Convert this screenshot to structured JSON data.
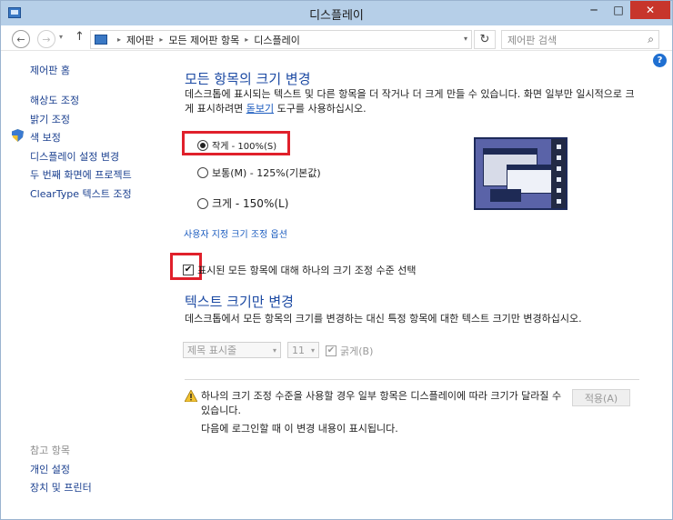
{
  "window": {
    "title": "디스플레이",
    "controls": {
      "minimize": "─",
      "maximize": "□",
      "close": "✕"
    }
  },
  "navbar": {
    "back": "←",
    "forward": "→",
    "dropdown": "▾",
    "up": "↑",
    "breadcrumbs": [
      "제어판",
      "모든 제어판 항목",
      "디스플레이"
    ],
    "crumb_separator": "▸",
    "address_dropdown": "▾",
    "refresh": "↻",
    "search_placeholder": "제어판 검색",
    "search_icon": "⌕"
  },
  "help": {
    "label": "?"
  },
  "sidebar": {
    "home": "제어판 홈",
    "items": [
      {
        "label": "해상도 조정"
      },
      {
        "label": "밝기 조정"
      },
      {
        "label": "색 보정",
        "icon": "shield-icon"
      },
      {
        "label": "디스플레이 설정 변경"
      },
      {
        "label": "두 번째 화면에 프로젝트"
      },
      {
        "label": "ClearType 텍스트 조정"
      }
    ],
    "see_also_heading": "참고 항목",
    "see_also": [
      {
        "label": "개인 설정"
      },
      {
        "label": "장치 및 프린터"
      }
    ]
  },
  "main": {
    "section1": {
      "title": "모든 항목의 크기 변경",
      "desc_before_link": "데스크톱에 표시되는 텍스트 및 다른 항목을 더 작거나 더 크게 만들 수 있습니다. 화면 일부만 일시적으로 크게 표시하려면 ",
      "desc_link": "돋보기",
      "desc_after_link": " 도구를 사용하십시오.",
      "options": [
        {
          "label": "작게 - 100%(S)",
          "checked": true
        },
        {
          "label": "보통(M) - 125%(기본값)",
          "checked": false
        },
        {
          "label": "크게 - 150%(L)",
          "checked": false
        }
      ],
      "custom_link": "사용자 지정 크기 조정 옵션",
      "single_scale_checkbox": {
        "label": "표시된 모든 항목에 대해 하나의 크기 조정 수준 선택",
        "checked": true,
        "mark": "✔"
      }
    },
    "section2": {
      "title": "텍스트 크기만 변경",
      "desc": "데스크톱에서 모든 항목의 크기를 변경하는 대신 특정 항목에 대한 텍스트 크기만 변경하십시오.",
      "item_select": "제목 표시줄",
      "size_select": "11",
      "bold_label": "굵게(B)",
      "bold_checked": true,
      "select_arrow": "▾"
    },
    "warning": {
      "line1": "하나의 크기 조정 수준을 사용할 경우 일부 항목은 디스플레이에 따라 크기가 달라질 수",
      "line2": "있습니다.",
      "line3": "다음에 로그인할 때 이 변경 내용이 표시됩니다."
    },
    "apply_button": "적용(A)"
  },
  "colors": {
    "titlebar": "#b6cfe8",
    "heading_blue": "#1c4aa3",
    "link_blue": "#1a5bbf",
    "highlight_red": "#e0202b",
    "close_red": "#c7352b"
  }
}
